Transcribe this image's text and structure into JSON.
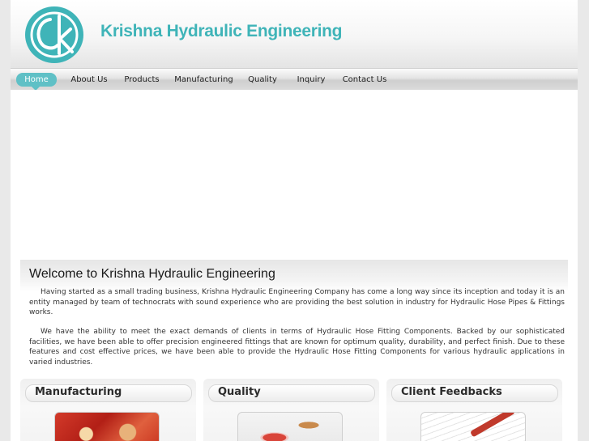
{
  "header": {
    "site_title": "Krishna Hydraulic Engineering",
    "logo_name": "kh-logo",
    "brand_color": "#3fb4b8"
  },
  "nav": {
    "items": [
      {
        "label": "Home",
        "active": true
      },
      {
        "label": "About Us"
      },
      {
        "label": "Products"
      },
      {
        "label": "Manufacturing"
      },
      {
        "label": "Quality"
      },
      {
        "label": "Inquiry"
      },
      {
        "label": "Contact Us"
      }
    ],
    "active_color": "#5fc0c6"
  },
  "welcome": {
    "title": "Welcome to Krishna Hydraulic Engineering",
    "paragraph1": "Having started as a small trading business, Krishna Hydraulic Engineering Company has come a long way since its inception and today it is an entity managed by team of technocrats with sound experience who are providing the best solution in industry for Hydraulic Hose Pipes & Fittings works.",
    "paragraph2": "We have the ability to meet the exact demands of clients in terms of Hydraulic Hose Fitting Components. Backed by our sophisticated facilities, we have been able to offer precision engineered fittings that are known for optimum quality, durability, and perfect finish. Due to these features and cost effective prices, we have been able to provide the Hydraulic Hose Fitting Components for various hydraulic applications in varied industries."
  },
  "boxes": [
    {
      "title": "Manufacturing",
      "image": "hose-fittings-photo"
    },
    {
      "title": "Quality",
      "image": "rubber-stamp-photo"
    },
    {
      "title": "Client Feedbacks",
      "image": "feedback-form-photo"
    }
  ]
}
